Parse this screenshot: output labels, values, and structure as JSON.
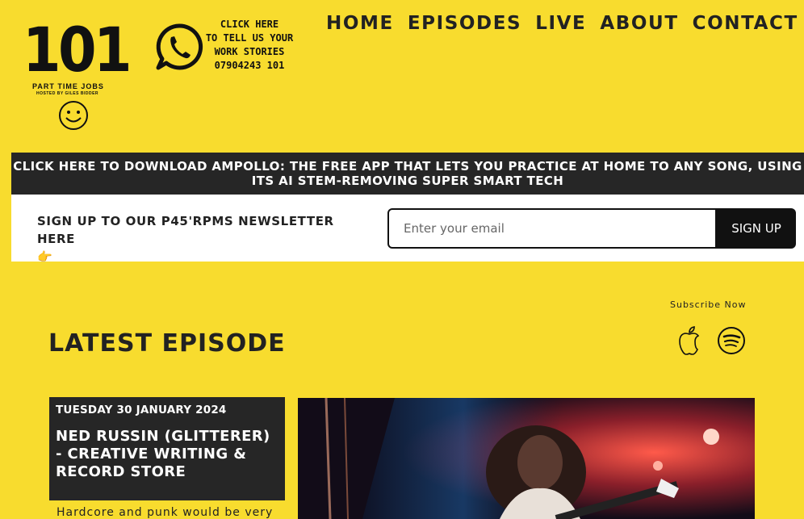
{
  "logo": {
    "number": "101",
    "subtitle": "PART TIME JOBS",
    "hosted": "HOSTED BY GILES BIDDER"
  },
  "whatsapp": {
    "lines": [
      "CLICK HERE",
      "TO TELL US YOUR",
      "WORK STORIES",
      "07904243 101"
    ]
  },
  "nav": [
    "HOME",
    "EPISODES",
    "LIVE",
    "ABOUT",
    "CONTACT"
  ],
  "banner": {
    "text": "CLICK HERE TO DOWNLOAD AMPOLLO: THE FREE APP THAT LETS YOU PRACTICE AT HOME TO ANY SONG, USING ITS AI STEM-REMOVING SUPER SMART TECH"
  },
  "newsletter": {
    "text": "SIGN UP TO OUR P45'RPMS NEWSLETTER HERE",
    "emoji": "👉",
    "placeholder": "Enter your email",
    "button": "SIGN UP"
  },
  "subscribe": {
    "label": "Subscribe Now"
  },
  "latest": {
    "heading": "LATEST EPISODE"
  },
  "episode": {
    "date": "TUESDAY 30 JANUARY 2024",
    "title": "NED RUSSIN (GLITTERER) - CREATIVE WRITING & RECORD STORE",
    "description": "Hardcore and punk would be very"
  },
  "colors": {
    "background": "#f8dc2e",
    "dark": "#262626",
    "text": "#222222"
  }
}
